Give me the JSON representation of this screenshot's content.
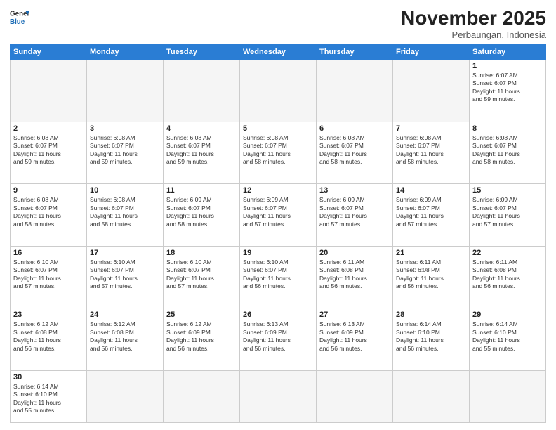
{
  "header": {
    "logo_general": "General",
    "logo_blue": "Blue",
    "month_title": "November 2025",
    "location": "Perbaungan, Indonesia"
  },
  "days_of_week": [
    "Sunday",
    "Monday",
    "Tuesday",
    "Wednesday",
    "Thursday",
    "Friday",
    "Saturday"
  ],
  "weeks": [
    [
      {
        "day": "",
        "info": ""
      },
      {
        "day": "",
        "info": ""
      },
      {
        "day": "",
        "info": ""
      },
      {
        "day": "",
        "info": ""
      },
      {
        "day": "",
        "info": ""
      },
      {
        "day": "",
        "info": ""
      },
      {
        "day": "1",
        "info": "Sunrise: 6:07 AM\nSunset: 6:07 PM\nDaylight: 11 hours\nand 59 minutes."
      }
    ],
    [
      {
        "day": "2",
        "info": "Sunrise: 6:08 AM\nSunset: 6:07 PM\nDaylight: 11 hours\nand 59 minutes."
      },
      {
        "day": "3",
        "info": "Sunrise: 6:08 AM\nSunset: 6:07 PM\nDaylight: 11 hours\nand 59 minutes."
      },
      {
        "day": "4",
        "info": "Sunrise: 6:08 AM\nSunset: 6:07 PM\nDaylight: 11 hours\nand 59 minutes."
      },
      {
        "day": "5",
        "info": "Sunrise: 6:08 AM\nSunset: 6:07 PM\nDaylight: 11 hours\nand 58 minutes."
      },
      {
        "day": "6",
        "info": "Sunrise: 6:08 AM\nSunset: 6:07 PM\nDaylight: 11 hours\nand 58 minutes."
      },
      {
        "day": "7",
        "info": "Sunrise: 6:08 AM\nSunset: 6:07 PM\nDaylight: 11 hours\nand 58 minutes."
      },
      {
        "day": "8",
        "info": "Sunrise: 6:08 AM\nSunset: 6:07 PM\nDaylight: 11 hours\nand 58 minutes."
      }
    ],
    [
      {
        "day": "9",
        "info": "Sunrise: 6:08 AM\nSunset: 6:07 PM\nDaylight: 11 hours\nand 58 minutes."
      },
      {
        "day": "10",
        "info": "Sunrise: 6:08 AM\nSunset: 6:07 PM\nDaylight: 11 hours\nand 58 minutes."
      },
      {
        "day": "11",
        "info": "Sunrise: 6:09 AM\nSunset: 6:07 PM\nDaylight: 11 hours\nand 58 minutes."
      },
      {
        "day": "12",
        "info": "Sunrise: 6:09 AM\nSunset: 6:07 PM\nDaylight: 11 hours\nand 57 minutes."
      },
      {
        "day": "13",
        "info": "Sunrise: 6:09 AM\nSunset: 6:07 PM\nDaylight: 11 hours\nand 57 minutes."
      },
      {
        "day": "14",
        "info": "Sunrise: 6:09 AM\nSunset: 6:07 PM\nDaylight: 11 hours\nand 57 minutes."
      },
      {
        "day": "15",
        "info": "Sunrise: 6:09 AM\nSunset: 6:07 PM\nDaylight: 11 hours\nand 57 minutes."
      }
    ],
    [
      {
        "day": "16",
        "info": "Sunrise: 6:10 AM\nSunset: 6:07 PM\nDaylight: 11 hours\nand 57 minutes."
      },
      {
        "day": "17",
        "info": "Sunrise: 6:10 AM\nSunset: 6:07 PM\nDaylight: 11 hours\nand 57 minutes."
      },
      {
        "day": "18",
        "info": "Sunrise: 6:10 AM\nSunset: 6:07 PM\nDaylight: 11 hours\nand 57 minutes."
      },
      {
        "day": "19",
        "info": "Sunrise: 6:10 AM\nSunset: 6:07 PM\nDaylight: 11 hours\nand 56 minutes."
      },
      {
        "day": "20",
        "info": "Sunrise: 6:11 AM\nSunset: 6:08 PM\nDaylight: 11 hours\nand 56 minutes."
      },
      {
        "day": "21",
        "info": "Sunrise: 6:11 AM\nSunset: 6:08 PM\nDaylight: 11 hours\nand 56 minutes."
      },
      {
        "day": "22",
        "info": "Sunrise: 6:11 AM\nSunset: 6:08 PM\nDaylight: 11 hours\nand 56 minutes."
      }
    ],
    [
      {
        "day": "23",
        "info": "Sunrise: 6:12 AM\nSunset: 6:08 PM\nDaylight: 11 hours\nand 56 minutes."
      },
      {
        "day": "24",
        "info": "Sunrise: 6:12 AM\nSunset: 6:08 PM\nDaylight: 11 hours\nand 56 minutes."
      },
      {
        "day": "25",
        "info": "Sunrise: 6:12 AM\nSunset: 6:09 PM\nDaylight: 11 hours\nand 56 minutes."
      },
      {
        "day": "26",
        "info": "Sunrise: 6:13 AM\nSunset: 6:09 PM\nDaylight: 11 hours\nand 56 minutes."
      },
      {
        "day": "27",
        "info": "Sunrise: 6:13 AM\nSunset: 6:09 PM\nDaylight: 11 hours\nand 56 minutes."
      },
      {
        "day": "28",
        "info": "Sunrise: 6:14 AM\nSunset: 6:10 PM\nDaylight: 11 hours\nand 56 minutes."
      },
      {
        "day": "29",
        "info": "Sunrise: 6:14 AM\nSunset: 6:10 PM\nDaylight: 11 hours\nand 55 minutes."
      }
    ],
    [
      {
        "day": "30",
        "info": "Sunrise: 6:14 AM\nSunset: 6:10 PM\nDaylight: 11 hours\nand 55 minutes."
      },
      {
        "day": "",
        "info": ""
      },
      {
        "day": "",
        "info": ""
      },
      {
        "day": "",
        "info": ""
      },
      {
        "day": "",
        "info": ""
      },
      {
        "day": "",
        "info": ""
      },
      {
        "day": "",
        "info": ""
      }
    ]
  ]
}
